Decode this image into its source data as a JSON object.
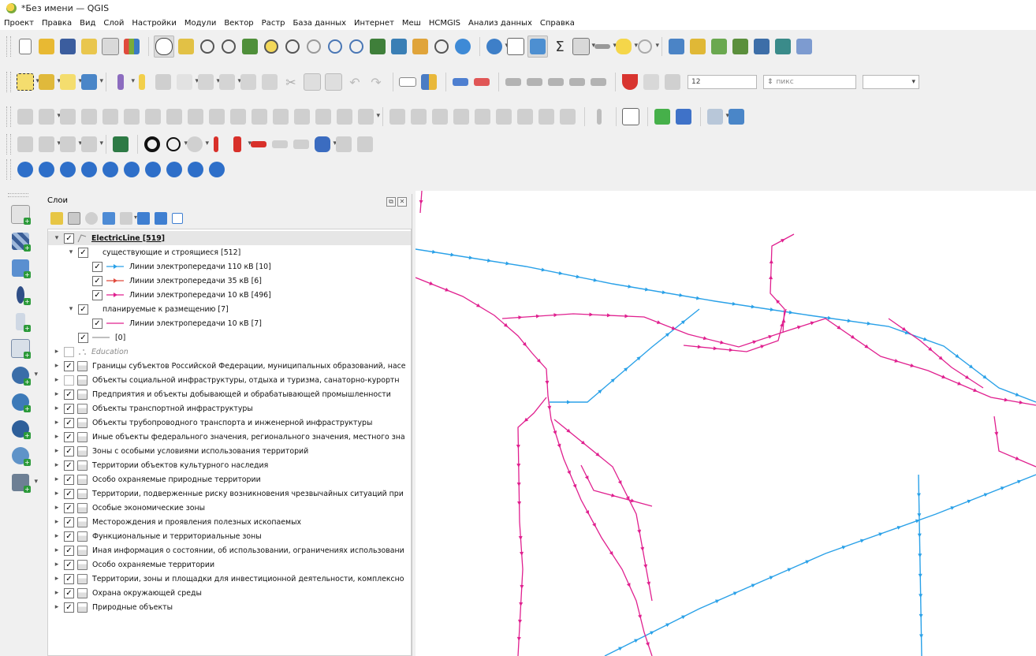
{
  "window": {
    "title": "*Без имени — QGIS"
  },
  "menu": [
    "Проект",
    "Правка",
    "Вид",
    "Слой",
    "Настройки",
    "Модули",
    "Вектор",
    "Растр",
    "База данных",
    "Интернет",
    "Меш",
    "HCMGIS",
    "Анализ данных",
    "Справка"
  ],
  "style_toolbar": {
    "size_value": "12",
    "unit_label": "пикс"
  },
  "layers_panel": {
    "title": "Слои",
    "tree": [
      {
        "label": "ElectricLine [519]",
        "checked": true,
        "expanded": true,
        "level": 0,
        "kind": "line-layer",
        "bold": true
      },
      {
        "label": "существующие и строящиеся [512]",
        "checked": true,
        "expanded": true,
        "level": 1,
        "kind": "rule"
      },
      {
        "label": "Линии электропередачи 110 кВ [10]",
        "checked": true,
        "level": 2,
        "kind": "symbol",
        "color": "#2aa1e8"
      },
      {
        "label": "Линии электропередачи 35 кВ [6]",
        "checked": true,
        "level": 2,
        "kind": "symbol",
        "color": "#e04a3c"
      },
      {
        "label": "Линии электропередачи 10 кВ [496]",
        "checked": true,
        "level": 2,
        "kind": "symbol",
        "color": "#e0208f"
      },
      {
        "label": "планируемые к размещению [7]",
        "checked": true,
        "expanded": true,
        "level": 1,
        "kind": "rule"
      },
      {
        "label": "Линии электропередачи 10 кВ [7]",
        "checked": true,
        "level": 2,
        "kind": "symbol-plain",
        "color": "#e0208f"
      },
      {
        "label": "[0]",
        "checked": true,
        "level": 1,
        "kind": "symbol-plain",
        "color": "#999999"
      },
      {
        "label": "Education",
        "checked": false,
        "level": 0,
        "kind": "group-italic"
      },
      {
        "label": "Границы субъектов Российской Федерации, муниципальных образований, насе",
        "checked": true,
        "level": 0,
        "kind": "group"
      },
      {
        "label": "Объекты социальной инфраструктуры, отдыха и туризма, санаторно-курортн",
        "checked": false,
        "level": 0,
        "kind": "group"
      },
      {
        "label": "Предприятия и объекты добывающей и обрабатывающей промышленности",
        "checked": true,
        "level": 0,
        "kind": "group"
      },
      {
        "label": "Объекты транспортной инфраструктуры",
        "checked": true,
        "level": 0,
        "kind": "group"
      },
      {
        "label": "Объекты трубопроводного транспорта и инженерной инфраструктуры",
        "checked": true,
        "level": 0,
        "kind": "group"
      },
      {
        "label": "Иные объекты федерального значения, регионального значения, местного зна",
        "checked": true,
        "level": 0,
        "kind": "group"
      },
      {
        "label": "Зоны с особыми условиями использования территорий",
        "checked": true,
        "level": 0,
        "kind": "group"
      },
      {
        "label": "Территории объектов культурного наследия",
        "checked": true,
        "level": 0,
        "kind": "group"
      },
      {
        "label": "Особо охраняемые природные территории",
        "checked": true,
        "level": 0,
        "kind": "group"
      },
      {
        "label": "Территории, подверженные риску возникновения чрезвычайных ситуаций при",
        "checked": true,
        "level": 0,
        "kind": "group"
      },
      {
        "label": "Особые экономические зоны",
        "checked": true,
        "level": 0,
        "kind": "group"
      },
      {
        "label": "Месторождения и проявления полезных ископаемых",
        "checked": true,
        "level": 0,
        "kind": "group"
      },
      {
        "label": "Функциональные и территориальные зоны",
        "checked": true,
        "level": 0,
        "kind": "group"
      },
      {
        "label": "Иная информация о состоянии, об использовании, ограничениях использовани",
        "checked": true,
        "level": 0,
        "kind": "group"
      },
      {
        "label": "Особо охраняемые территории",
        "checked": true,
        "level": 0,
        "kind": "group"
      },
      {
        "label": "Территории, зоны и площадки для инвестиционной деятельности, комплексно",
        "checked": true,
        "level": 0,
        "kind": "group"
      },
      {
        "label": "Охрана окружающей среды",
        "checked": true,
        "level": 0,
        "kind": "group"
      },
      {
        "label": "Природные объекты",
        "checked": true,
        "level": 0,
        "kind": "group"
      }
    ]
  },
  "map": {
    "colors": {
      "line_110kv": "#2aa1e8",
      "line_10kv": "#e0208f"
    }
  }
}
